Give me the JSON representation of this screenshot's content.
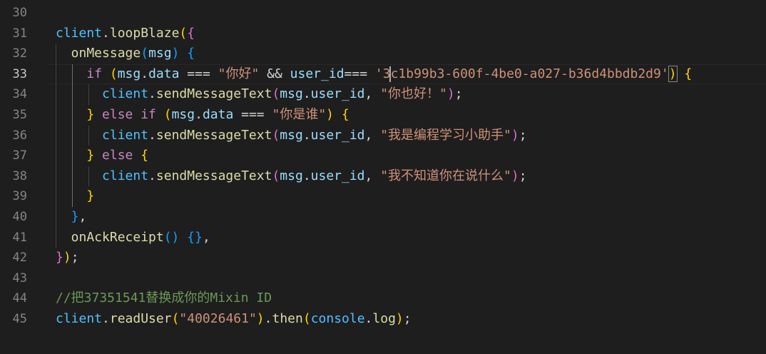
{
  "editor": {
    "lines": [
      {
        "number": "30",
        "active": false,
        "tokens": []
      },
      {
        "number": "31",
        "active": false,
        "tokens": [
          {
            "t": "client",
            "c": "k-var"
          },
          {
            "t": ".",
            "c": "k-op"
          },
          {
            "t": "loopBlaze",
            "c": "k-fn"
          },
          {
            "t": "(",
            "c": "k-b1"
          },
          {
            "t": "{",
            "c": "k-b2"
          }
        ]
      },
      {
        "number": "32",
        "active": false,
        "tokens": [
          {
            "t": "  onMessage",
            "c": "k-fn"
          },
          {
            "t": "(",
            "c": "k-b3"
          },
          {
            "t": "msg",
            "c": "k-id"
          },
          {
            "t": ")",
            "c": "k-b3"
          },
          {
            "t": " ",
            "c": "k-op"
          },
          {
            "t": "{",
            "c": "k-b3"
          }
        ]
      },
      {
        "number": "33",
        "active": true,
        "tokens": [
          {
            "t": "    if",
            "c": "k-ctl"
          },
          {
            "t": " ",
            "c": "k-op"
          },
          {
            "t": "(",
            "c": "k-b1"
          },
          {
            "t": "msg",
            "c": "k-id"
          },
          {
            "t": ".",
            "c": "k-op"
          },
          {
            "t": "data",
            "c": "k-id"
          },
          {
            "t": " === ",
            "c": "k-op"
          },
          {
            "t": "\"你好\"",
            "c": "k-str"
          },
          {
            "t": " && ",
            "c": "k-op"
          },
          {
            "t": "user_id",
            "c": "k-id"
          },
          {
            "t": "=== ",
            "c": "k-op"
          },
          {
            "t": "'3c1b99b3-600f-4be0-a027-b36d4bbdb2d9'",
            "c": "k-str"
          },
          {
            "t": ")",
            "c": "k-b1 k-hl"
          },
          {
            "t": " ",
            "c": "k-op"
          },
          {
            "t": "{",
            "c": "k-b1"
          }
        ]
      },
      {
        "number": "34",
        "active": false,
        "tokens": [
          {
            "t": "      client",
            "c": "k-var"
          },
          {
            "t": ".",
            "c": "k-op"
          },
          {
            "t": "sendMessageText",
            "c": "k-fn"
          },
          {
            "t": "(",
            "c": "k-b2"
          },
          {
            "t": "msg",
            "c": "k-id"
          },
          {
            "t": ".",
            "c": "k-op"
          },
          {
            "t": "user_id",
            "c": "k-id"
          },
          {
            "t": ", ",
            "c": "k-op"
          },
          {
            "t": "\"你也好！\"",
            "c": "k-str"
          },
          {
            "t": ")",
            "c": "k-b2"
          },
          {
            "t": ";",
            "c": "k-op"
          }
        ]
      },
      {
        "number": "35",
        "active": false,
        "tokens": [
          {
            "t": "    }",
            "c": "k-b1"
          },
          {
            "t": " else if",
            "c": "k-ctl"
          },
          {
            "t": " ",
            "c": "k-op"
          },
          {
            "t": "(",
            "c": "k-b1"
          },
          {
            "t": "msg",
            "c": "k-id"
          },
          {
            "t": ".",
            "c": "k-op"
          },
          {
            "t": "data",
            "c": "k-id"
          },
          {
            "t": " === ",
            "c": "k-op"
          },
          {
            "t": "\"你是谁\"",
            "c": "k-str"
          },
          {
            "t": ")",
            "c": "k-b1"
          },
          {
            "t": " ",
            "c": "k-op"
          },
          {
            "t": "{",
            "c": "k-b1"
          }
        ]
      },
      {
        "number": "36",
        "active": false,
        "tokens": [
          {
            "t": "      client",
            "c": "k-var"
          },
          {
            "t": ".",
            "c": "k-op"
          },
          {
            "t": "sendMessageText",
            "c": "k-fn"
          },
          {
            "t": "(",
            "c": "k-b2"
          },
          {
            "t": "msg",
            "c": "k-id"
          },
          {
            "t": ".",
            "c": "k-op"
          },
          {
            "t": "user_id",
            "c": "k-id"
          },
          {
            "t": ", ",
            "c": "k-op"
          },
          {
            "t": "\"我是编程学习小助手\"",
            "c": "k-str"
          },
          {
            "t": ")",
            "c": "k-b2"
          },
          {
            "t": ";",
            "c": "k-op"
          }
        ]
      },
      {
        "number": "37",
        "active": false,
        "tokens": [
          {
            "t": "    }",
            "c": "k-b1"
          },
          {
            "t": " else",
            "c": "k-ctl"
          },
          {
            "t": " ",
            "c": "k-op"
          },
          {
            "t": "{",
            "c": "k-b1"
          }
        ]
      },
      {
        "number": "38",
        "active": false,
        "tokens": [
          {
            "t": "      client",
            "c": "k-var"
          },
          {
            "t": ".",
            "c": "k-op"
          },
          {
            "t": "sendMessageText",
            "c": "k-fn"
          },
          {
            "t": "(",
            "c": "k-b2"
          },
          {
            "t": "msg",
            "c": "k-id"
          },
          {
            "t": ".",
            "c": "k-op"
          },
          {
            "t": "user_id",
            "c": "k-id"
          },
          {
            "t": ", ",
            "c": "k-op"
          },
          {
            "t": "\"我不知道你在说什么\"",
            "c": "k-str"
          },
          {
            "t": ")",
            "c": "k-b2"
          },
          {
            "t": ";",
            "c": "k-op"
          }
        ]
      },
      {
        "number": "39",
        "active": false,
        "tokens": [
          {
            "t": "    }",
            "c": "k-b1"
          }
        ]
      },
      {
        "number": "40",
        "active": false,
        "tokens": [
          {
            "t": "  }",
            "c": "k-b3"
          },
          {
            "t": ",",
            "c": "k-op"
          }
        ]
      },
      {
        "number": "41",
        "active": false,
        "tokens": [
          {
            "t": "  onAckReceipt",
            "c": "k-fn"
          },
          {
            "t": "()",
            "c": "k-b3"
          },
          {
            "t": " ",
            "c": "k-op"
          },
          {
            "t": "{}",
            "c": "k-b3"
          },
          {
            "t": ",",
            "c": "k-op"
          }
        ]
      },
      {
        "number": "42",
        "active": false,
        "tokens": [
          {
            "t": "}",
            "c": "k-b2"
          },
          {
            "t": ")",
            "c": "k-b1"
          },
          {
            "t": ";",
            "c": "k-op"
          }
        ]
      },
      {
        "number": "43",
        "active": false,
        "tokens": []
      },
      {
        "number": "44",
        "active": false,
        "tokens": [
          {
            "t": "//把37351541替换成你的Mixin ID",
            "c": "k-cmt"
          }
        ]
      },
      {
        "number": "45",
        "active": false,
        "tokens": [
          {
            "t": "client",
            "c": "k-var"
          },
          {
            "t": ".",
            "c": "k-op"
          },
          {
            "t": "readUser",
            "c": "k-fn"
          },
          {
            "t": "(",
            "c": "k-b1"
          },
          {
            "t": "\"40026461\"",
            "c": "k-str"
          },
          {
            "t": ")",
            "c": "k-b1"
          },
          {
            "t": ".",
            "c": "k-op"
          },
          {
            "t": "then",
            "c": "k-fn"
          },
          {
            "t": "(",
            "c": "k-b1"
          },
          {
            "t": "console",
            "c": "k-var"
          },
          {
            "t": ".",
            "c": "k-op"
          },
          {
            "t": "log",
            "c": "k-fn"
          },
          {
            "t": ")",
            "c": "k-b1"
          },
          {
            "t": ";",
            "c": "k-op"
          }
        ]
      }
    ]
  }
}
